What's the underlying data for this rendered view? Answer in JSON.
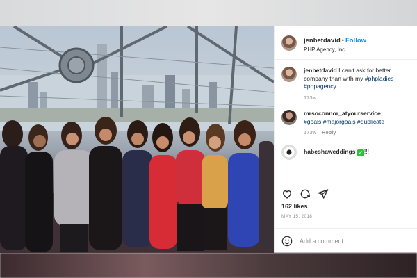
{
  "post": {
    "username": "jenbetdavid",
    "follow_label": "Follow",
    "location": "PHP Agency, Inc.",
    "caption": {
      "username": "jenbetdavid",
      "text": "I can't ask for better company than with my",
      "hashtags": [
        "#phpladies",
        "#phpagency"
      ],
      "age": "173w"
    },
    "comments": [
      {
        "username": "mrsoconnor_atyourservice",
        "hashtags": [
          "#goals",
          "#majorgoals",
          "#duplicate"
        ],
        "age": "173w",
        "reply_label": "Reply"
      },
      {
        "username": "habeshaweddings",
        "suffix": "!!!"
      }
    ],
    "likes": "162 likes",
    "date": "MAY 15, 2018",
    "add_comment_placeholder": "Add a comment...",
    "icons": [
      "heart-icon",
      "comment-icon",
      "share-icon",
      "emoji-icon",
      "verified-check-icon"
    ]
  }
}
